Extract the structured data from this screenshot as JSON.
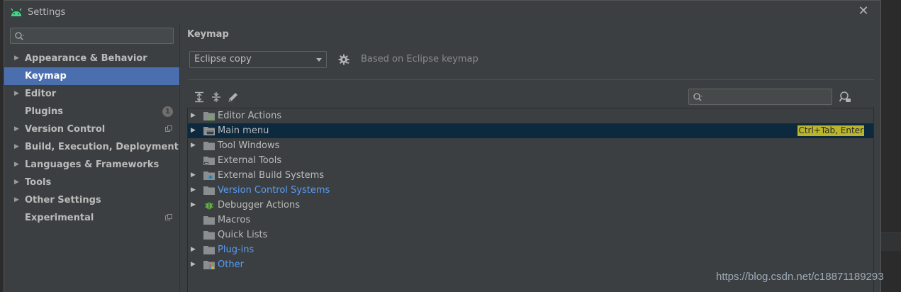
{
  "window": {
    "title": "Settings",
    "close_label": "✕"
  },
  "sidebar": {
    "search_placeholder": "",
    "items": [
      {
        "label": "Appearance & Behavior",
        "expandable": true
      },
      {
        "label": "Keymap",
        "selected": true
      },
      {
        "label": "Editor",
        "expandable": true
      },
      {
        "label": "Plugins",
        "badge": "1"
      },
      {
        "label": "Version Control",
        "expandable": true
      },
      {
        "label": "Build, Execution, Deployment",
        "expandable": true
      },
      {
        "label": "Languages & Frameworks",
        "expandable": true
      },
      {
        "label": "Tools",
        "expandable": true
      },
      {
        "label": "Other Settings",
        "expandable": true
      },
      {
        "label": "Experimental"
      }
    ]
  },
  "main": {
    "heading": "Keymap",
    "keymap_value": "Eclipse copy",
    "based_on": "Based on Eclipse keymap",
    "tree_search_placeholder": "",
    "tree": [
      {
        "label": "Editor Actions",
        "icon": "editor-actions-folder-icon"
      },
      {
        "label": "Main menu",
        "icon": "main-menu-folder-icon",
        "shortcut": "Ctrl+Tab, Enter",
        "selected": true
      },
      {
        "label": "Tool Windows",
        "icon": "folder-icon"
      },
      {
        "label": "External Tools",
        "icon": "external-tools-folder-icon"
      },
      {
        "label": "External Build Systems",
        "icon": "build-systems-folder-icon"
      },
      {
        "label": "Version Control Systems",
        "icon": "folder-icon",
        "link": true
      },
      {
        "label": "Debugger Actions",
        "icon": "bug-icon"
      },
      {
        "label": "Macros",
        "icon": "folder-icon"
      },
      {
        "label": "Quick Lists",
        "icon": "folder-icon"
      },
      {
        "label": "Plug-ins",
        "icon": "folder-icon",
        "link": true
      },
      {
        "label": "Other",
        "icon": "other-folder-icon",
        "link": true
      }
    ]
  },
  "watermark": "https://blog.csdn.net/c18871189293",
  "colors": {
    "background": "#3c3f41",
    "selection": "#4b6eaf",
    "tree_selection": "#0d293e",
    "link": "#589df6",
    "shortcut_highlight": "#bbb529"
  }
}
